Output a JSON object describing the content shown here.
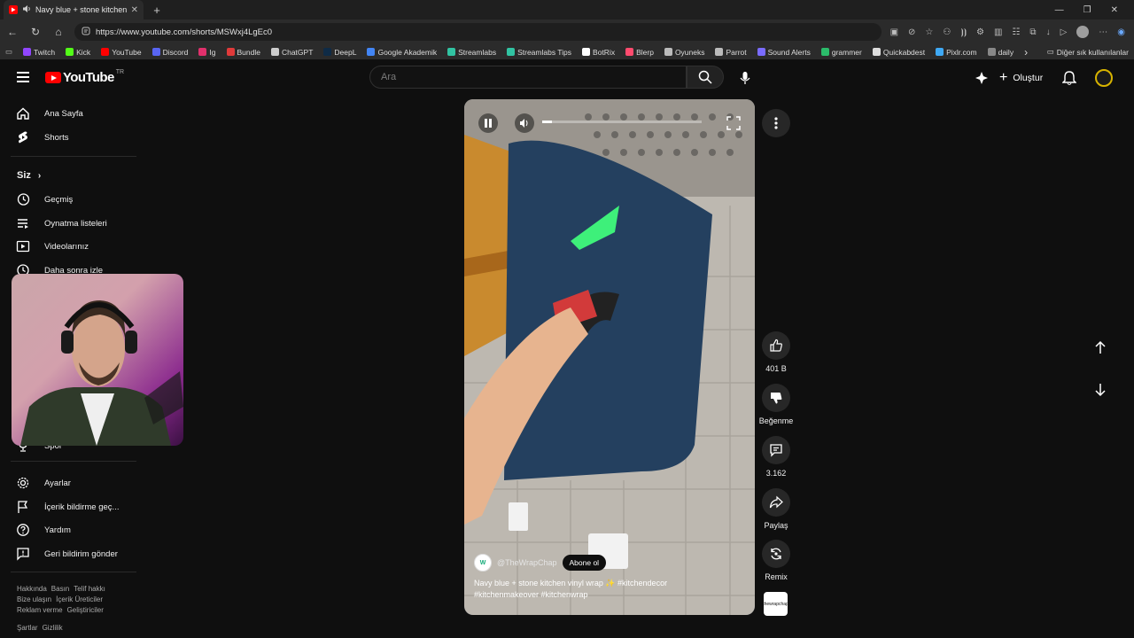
{
  "browser": {
    "tab_title": "Navy blue + stone kitchen vi",
    "url": "https://www.youtube.com/shorts/MSWxj4LgEc0",
    "bookmarks": [
      {
        "label": "Twitch",
        "color": "#9146ff"
      },
      {
        "label": "Kick",
        "color": "#53fc18"
      },
      {
        "label": "YouTube",
        "color": "#ff0000"
      },
      {
        "label": "Discord",
        "color": "#5865f2"
      },
      {
        "label": "Ig",
        "color": "#e1306c"
      },
      {
        "label": "Bundle",
        "color": "#e03a3a"
      },
      {
        "label": "ChatGPT",
        "color": "#cccccc"
      },
      {
        "label": "DeepL",
        "color": "#0f2b46"
      },
      {
        "label": "Google Akademik",
        "color": "#4285f4"
      },
      {
        "label": "Streamlabs",
        "color": "#31c3a2"
      },
      {
        "label": "Streamlabs Tips",
        "color": "#31c3a2"
      },
      {
        "label": "BotRix",
        "color": "#ffffff"
      },
      {
        "label": "Blerp",
        "color": "#ff4b6e"
      },
      {
        "label": "Oyuneks",
        "color": "#bbbbbb"
      },
      {
        "label": "Parrot",
        "color": "#bbbbbb"
      },
      {
        "label": "Sound Alerts",
        "color": "#7a6cff"
      },
      {
        "label": "grammer",
        "color": "#2bbb6a"
      },
      {
        "label": "Quickabdest",
        "color": "#dddddd"
      },
      {
        "label": "Pixlr.com",
        "color": "#3fa9f5"
      },
      {
        "label": "daily",
        "color": "#888888"
      }
    ],
    "bookmarks_more": "Diğer sık kullanılanlar"
  },
  "youtube": {
    "logo_text": "YouTube",
    "logo_region": "TR",
    "search_placeholder": "Ara",
    "create_label": "Oluştur"
  },
  "sidebar": {
    "primary": [
      {
        "label": "Ana Sayfa",
        "icon": "home-icon"
      },
      {
        "label": "Shorts",
        "icon": "shorts-icon"
      }
    ],
    "you_heading": "Siz",
    "you_items": [
      {
        "label": "Geçmiş",
        "icon": "history-icon"
      },
      {
        "label": "Oynatma listeleri",
        "icon": "playlists-icon"
      },
      {
        "label": "Videolarınız",
        "icon": "your-videos-icon"
      },
      {
        "label": "Daha sonra izle",
        "icon": "watch-later-icon"
      }
    ],
    "partial_item": "Spor",
    "settings_items": [
      {
        "label": "Ayarlar",
        "icon": "settings-icon"
      },
      {
        "label": "İçerik bildirme geç...",
        "icon": "flag-icon"
      },
      {
        "label": "Yardım",
        "icon": "help-icon"
      },
      {
        "label": "Geri bildirim gönder",
        "icon": "feedback-icon"
      }
    ],
    "footer_line1": [
      "Hakkında",
      "Basın",
      "Telif hakkı"
    ],
    "footer_line2": [
      "Bize ulaşın",
      "İçerik Üreticiler"
    ],
    "footer_line3": [
      "Reklam verme",
      "Geliştiriciler"
    ],
    "footer_line4": [
      "Şartlar",
      "Gizlilik"
    ]
  },
  "short": {
    "channel": "@TheWrapChap",
    "subscribe_label": "Abone ol",
    "caption_line1": "Navy blue + stone kitchen vinyl wrap ✨ #kitchendecor",
    "caption_line2": "#kitchenmakeover #kitchenwrap",
    "progress": 0.06,
    "likes": "401 B",
    "dislike_label": "Beğenme",
    "comments": "3.162",
    "share_label": "Paylaş",
    "remix_label": "Remix",
    "thumb_text": "thewrapchap"
  }
}
